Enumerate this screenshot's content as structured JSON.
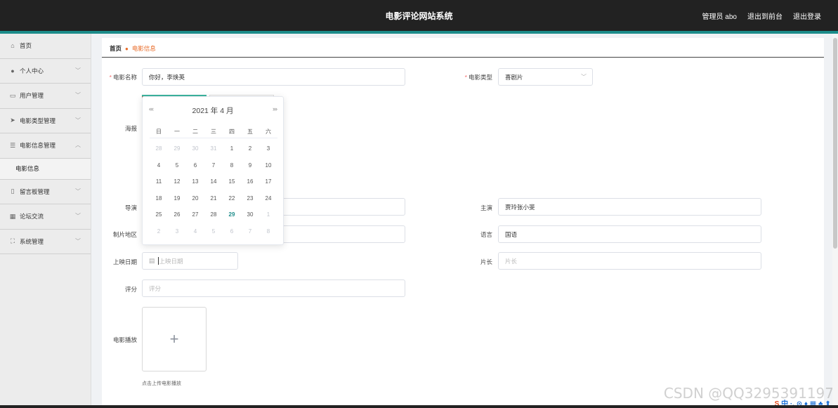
{
  "header": {
    "title": "电影评论网站系统",
    "admin": "管理员 abo",
    "to_front": "退出到前台",
    "logout": "退出登录"
  },
  "sidebar": {
    "items": [
      {
        "label": "首页",
        "icon": "home-icon"
      },
      {
        "label": "个人中心",
        "icon": "user-icon"
      },
      {
        "label": "用户管理",
        "icon": "chat-icon"
      },
      {
        "label": "电影类型管理",
        "icon": "send-icon"
      },
      {
        "label": "电影信息管理",
        "icon": "list-icon"
      },
      {
        "label": "留言板管理",
        "icon": "phone-icon"
      },
      {
        "label": "论坛交流",
        "icon": "grid-icon"
      },
      {
        "label": "系统管理",
        "icon": "frame-icon"
      }
    ],
    "sub_item": "电影信息"
  },
  "breadcrumb": {
    "home": "首页",
    "current": "电影信息"
  },
  "form": {
    "movie_name_label": "电影名称",
    "movie_name_value": "你好，李焕英",
    "movie_type_label": "电影类型",
    "movie_type_value": "喜剧片",
    "poster_label": "海报",
    "director_label": "导演",
    "actor_label": "主演",
    "actor_value": "贾玲张小斐",
    "region_label": "制片地区",
    "language_label": "语言",
    "language_value": "国语",
    "release_label": "上映日期",
    "release_placeholder": "上映日期",
    "duration_label": "片长",
    "duration_placeholder": "片长",
    "score_label": "评分",
    "score_placeholder": "评分",
    "play_label": "电影播放",
    "upload_tip": "点击上传电影播放"
  },
  "datepicker": {
    "title": "2021 年  4 月",
    "prev": "«‹",
    "next": "›»",
    "weekdays": [
      "日",
      "一",
      "二",
      "三",
      "四",
      "五",
      "六"
    ],
    "rows": [
      [
        "28",
        "29",
        "30",
        "31",
        "1",
        "2",
        "3"
      ],
      [
        "4",
        "5",
        "6",
        "7",
        "8",
        "9",
        "10"
      ],
      [
        "11",
        "12",
        "13",
        "14",
        "15",
        "16",
        "17"
      ],
      [
        "18",
        "19",
        "20",
        "21",
        "22",
        "23",
        "24"
      ],
      [
        "25",
        "26",
        "27",
        "28",
        "29",
        "30",
        "1"
      ],
      [
        "2",
        "3",
        "4",
        "5",
        "6",
        "7",
        "8"
      ]
    ],
    "today": "29"
  },
  "watermark": "CSDN @QQ3295391197",
  "tray": "中 ·, ⊙ ♦ ▦ ♣ ⬆ ▮",
  "colors": {
    "header_bg": "#222222",
    "accent": "#1c8c8a",
    "breadcrumb_active": "#e86a26",
    "required": "#f56c6c"
  }
}
